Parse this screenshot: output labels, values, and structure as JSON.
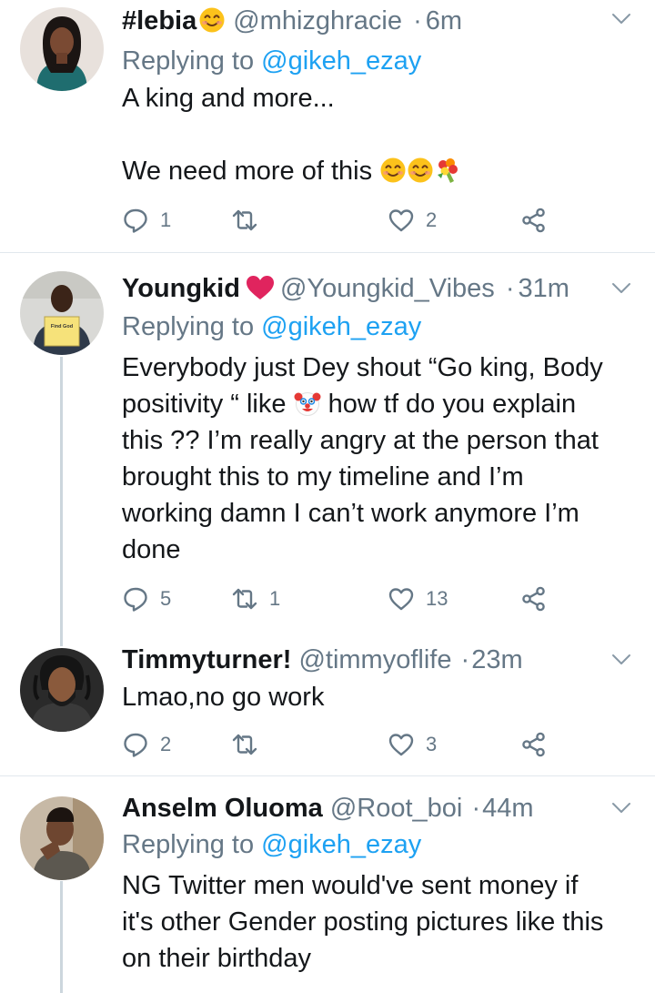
{
  "tweets": [
    {
      "name": "#lebia",
      "handle": "@mhizghracie",
      "time": "6m",
      "replying_label": "Replying to",
      "replying_to": "@gikeh_ezay",
      "line1": "A king and more...",
      "line2": "We need more of this",
      "replies": "1",
      "retweets": "",
      "likes": "2"
    },
    {
      "name": "Youngkid",
      "handle": "@Youngkid_Vibes",
      "time": "31m",
      "replying_label": "Replying to",
      "replying_to": "@gikeh_ezay",
      "lines": [
        "Everybody just Dey shout “Go king, Body",
        "positivity “ like",
        "how tf do you explain",
        "this ?? I’m really angry at the person that",
        "brought this to my timeline and I’m",
        "working damn I can’t work anymore I’m",
        "done"
      ],
      "replies": "5",
      "retweets": "1",
      "likes": "13",
      "avatar_book_text": "Find God"
    },
    {
      "name": "Timmyturner!",
      "handle": "@timmyoflife",
      "time": "23m",
      "text": "Lmao,no go work",
      "replies": "2",
      "retweets": "",
      "likes": "3"
    },
    {
      "name": "Anselm Oluoma",
      "handle": "@Root_boi",
      "time": "44m",
      "replying_label": "Replying to",
      "replying_to": "@gikeh_ezay",
      "lines": [
        "NG Twitter men would've sent money if",
        "it's other Gender posting pictures like this",
        "on their birthday"
      ]
    }
  ],
  "separator": "·",
  "colors": {
    "name": "#14171a",
    "secondary": "#657786",
    "link": "#1da1f2",
    "divider": "#e1e8ed",
    "thread": "#ccd6dd",
    "heart": "#e0245e"
  },
  "icons": [
    "reply-icon",
    "retweet-icon",
    "like-icon",
    "share-icon",
    "chevron-down-icon"
  ]
}
